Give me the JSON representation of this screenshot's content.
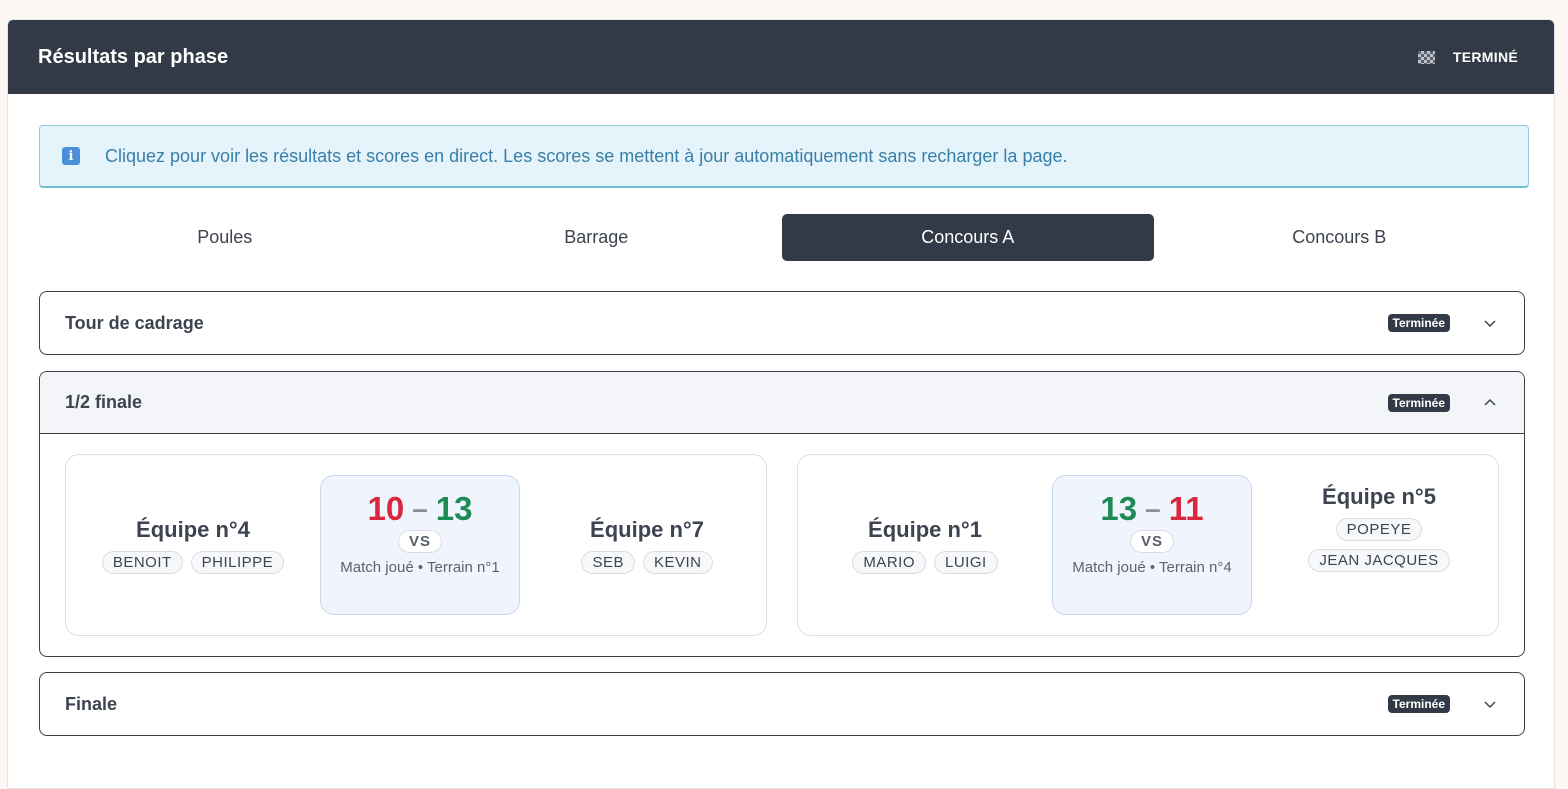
{
  "header": {
    "title": "Résultats par phase",
    "status": "TERMINÉ",
    "status_icon": "checkered-flag-icon"
  },
  "info": {
    "text": "Cliquez pour voir les résultats et scores en direct. Les scores se mettent à jour automatiquement sans recharger la page."
  },
  "tabs": [
    {
      "label": "Poules",
      "active": false
    },
    {
      "label": "Barrage",
      "active": false
    },
    {
      "label": "Concours A",
      "active": true
    },
    {
      "label": "Concours B",
      "active": false
    }
  ],
  "sections": [
    {
      "title": "Tour de cadrage",
      "badge": "Terminée",
      "expanded": false
    },
    {
      "title": "1/2 finale",
      "badge": "Terminée",
      "expanded": true,
      "matches": [
        {
          "team1": {
            "name": "Équipe n°4",
            "players": [
              "BENOIT",
              "PHILIPPE"
            ]
          },
          "score1": "10",
          "score2": "13",
          "vs": "VS",
          "meta": "Match joué • Terrain n°1",
          "team2": {
            "name": "Équipe n°7",
            "players": [
              "SEB",
              "KEVIN"
            ]
          }
        },
        {
          "team1": {
            "name": "Équipe n°1",
            "players": [
              "MARIO",
              "LUIGI"
            ]
          },
          "score1": "13",
          "score2": "11",
          "vs": "VS",
          "meta": "Match joué • Terrain n°4",
          "team2": {
            "name": "Équipe n°5",
            "players": [
              "POPEYE",
              "JEAN JACQUES"
            ]
          }
        }
      ]
    },
    {
      "title": "Finale",
      "badge": "Terminée",
      "expanded": false
    }
  ],
  "colors": {
    "dark": "#323a47",
    "win": "#1d8b54",
    "lose": "#d9273d",
    "info_bg": "#e5f3fa",
    "info_text": "#3a7fa8"
  }
}
